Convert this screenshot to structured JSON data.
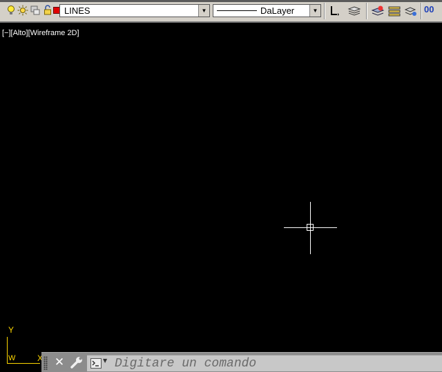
{
  "toolbar": {
    "layer_name": "LINES",
    "layer_color": "#e00000",
    "linetype_name": "DaLayer",
    "icons": [
      "lightbulb-icon",
      "sun-icon",
      "viewport-freeze-icon",
      "lock-icon",
      "layer-color-swatch",
      "make-current-icon",
      "layer-states-icon",
      "layer-previous-icon",
      "layer-manager-icon",
      "layer-isolate-icon",
      "lineweight-icon"
    ],
    "partial_right_text": "00"
  },
  "viewport": {
    "label": "[−][Alto][Wireframe 2D]"
  },
  "ucs": {
    "y_label": "Y",
    "w_label": "W",
    "x_label": "X",
    "color": "#ffd800"
  },
  "command_line": {
    "close_label": "✕",
    "placeholder": "Digitare un comando"
  }
}
